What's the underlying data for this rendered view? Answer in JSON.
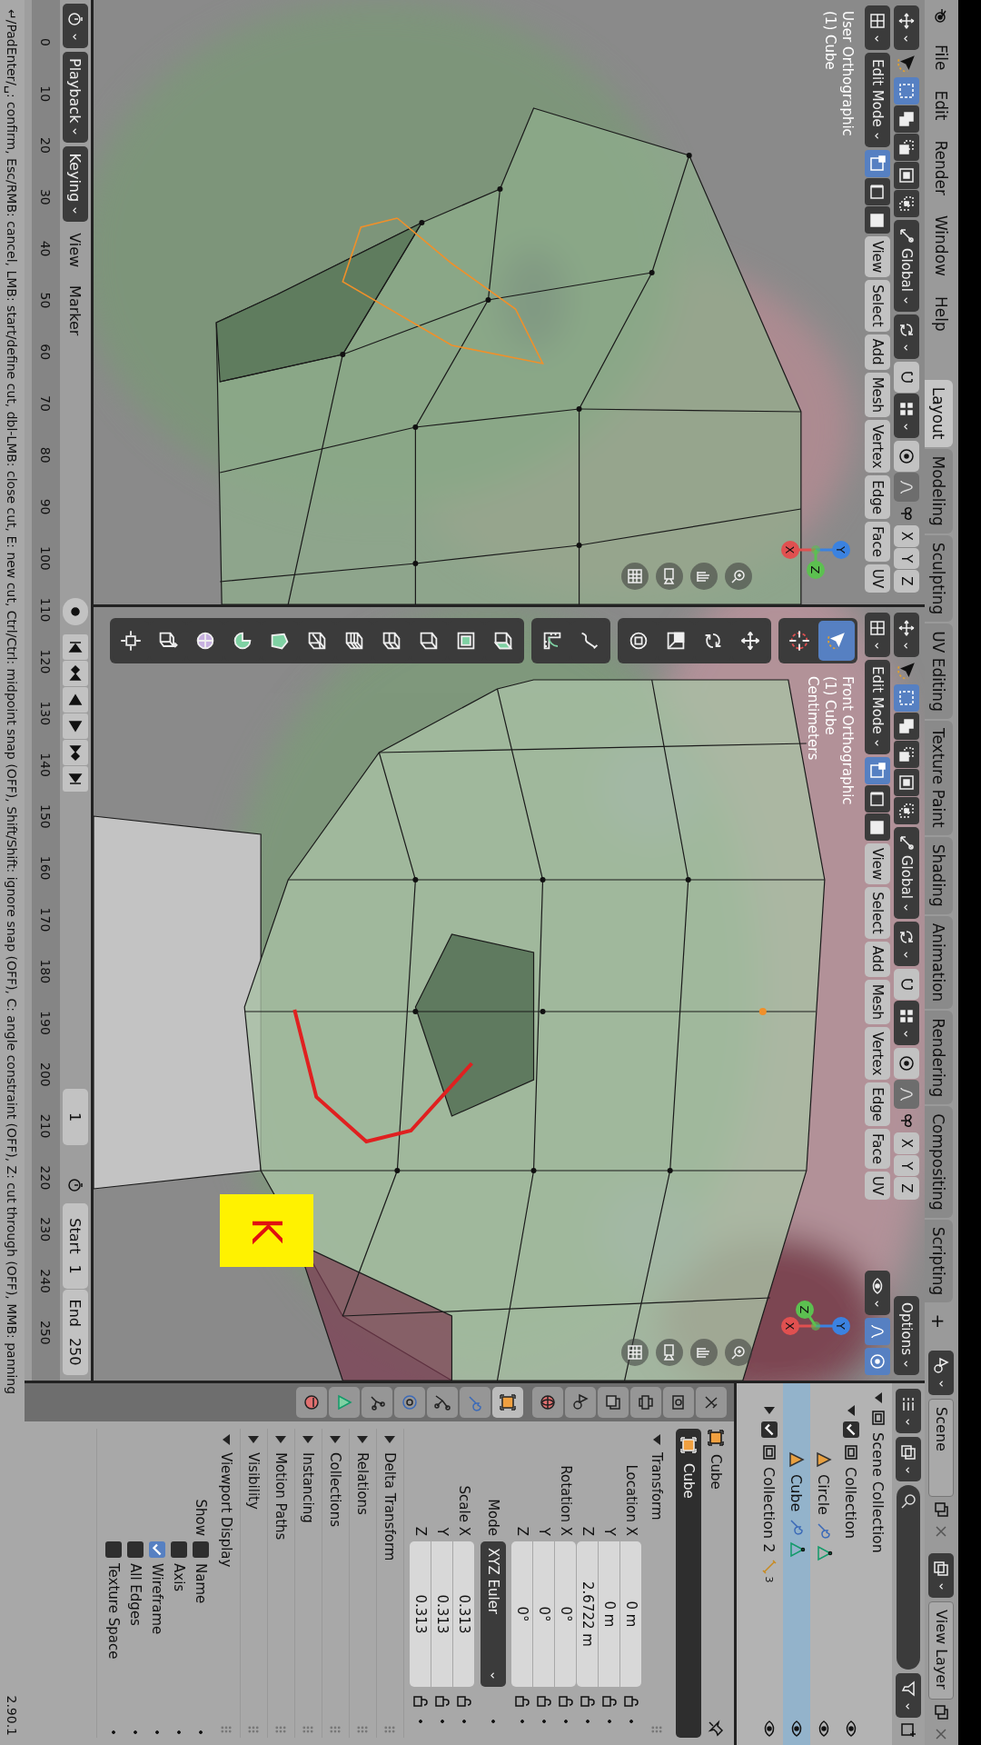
{
  "topbar": {
    "menus": [
      "File",
      "Edit",
      "Render",
      "Window",
      "Help"
    ],
    "workspaces": [
      {
        "label": "Layout",
        "selected": true
      },
      {
        "label": "Modeling",
        "selected": false
      },
      {
        "label": "Sculpting",
        "selected": false
      },
      {
        "label": "UV Editing",
        "selected": false
      },
      {
        "label": "Texture Paint",
        "selected": false
      },
      {
        "label": "Shading",
        "selected": false
      },
      {
        "label": "Animation",
        "selected": false
      },
      {
        "label": "Rendering",
        "selected": false
      },
      {
        "label": "Compositing",
        "selected": false
      },
      {
        "label": "Scripting",
        "selected": false
      }
    ],
    "add_tab": "+",
    "scene": "Scene",
    "view_layer": "View Layer"
  },
  "viewports": [
    {
      "kind": "user",
      "mode": "Edit Mode",
      "orientation": "Global",
      "box_modes": [
        {
          "selected": true
        },
        {
          "selected": false
        },
        {
          "selected": false
        },
        {
          "selected": false
        },
        {
          "selected": false
        }
      ],
      "mesh_select": [
        {
          "selected": true
        },
        {
          "selected": false
        },
        {
          "selected": false
        }
      ],
      "menus": [
        "View",
        "Select",
        "Add",
        "Mesh",
        "Vertex",
        "Edge",
        "Face",
        "UV"
      ],
      "mirror": [
        {
          "label": "X",
          "on": false
        },
        {
          "label": "Y",
          "on": false
        },
        {
          "label": "Z",
          "on": false
        }
      ],
      "info": [
        "User Orthographic",
        "(1) Cube"
      ],
      "gizmo": [
        "X",
        "Y",
        "Z"
      ]
    },
    {
      "kind": "front",
      "mode": "Edit Mode",
      "orientation": "Global",
      "box_modes": [
        {
          "selected": true
        },
        {
          "selected": false
        },
        {
          "selected": false
        },
        {
          "selected": false
        },
        {
          "selected": false
        }
      ],
      "mesh_select": [
        {
          "selected": true
        },
        {
          "selected": false
        },
        {
          "selected": false
        }
      ],
      "menus": [
        "View",
        "Select",
        "Add",
        "Mesh",
        "Vertex",
        "Edge",
        "Face",
        "UV"
      ],
      "mirror": [
        {
          "label": "X",
          "on": false
        },
        {
          "label": "Y",
          "on": false
        },
        {
          "label": "Z",
          "on": false
        }
      ],
      "info": [
        "Front Orthographic",
        "(1) Cube",
        "Centimeters"
      ],
      "gizmo": [
        "X",
        "Y",
        "Z"
      ],
      "options": "Options",
      "key_hint": "K",
      "tool_groups": [
        {
          "tools": [
            {
              "selected": true
            },
            {
              "selected": false
            }
          ]
        },
        {
          "tools": [
            {
              "selected": false
            },
            {
              "selected": false
            },
            {
              "selected": false
            },
            {
              "selected": false
            }
          ]
        },
        {
          "tools": [
            {
              "selected": false
            },
            {
              "selected": false
            }
          ]
        },
        {
          "tools": [
            {
              "selected": false
            },
            {
              "selected": false
            },
            {
              "selected": false
            },
            {
              "selected": false
            },
            {
              "selected": false
            },
            {
              "selected": false
            },
            {
              "selected": false
            },
            {
              "selected": false
            },
            {
              "selected": false
            },
            {
              "selected": false
            },
            {
              "selected": false
            }
          ]
        }
      ]
    }
  ],
  "timeline": {
    "menus": [
      {
        "label": "Playback",
        "dropdown": true
      },
      {
        "label": "Keying",
        "dropdown": true
      },
      {
        "label": "View",
        "dropdown": false
      },
      {
        "label": "Marker",
        "dropdown": false
      }
    ],
    "current_frame": "1",
    "start_label": "Start",
    "start": "1",
    "end_label": "End",
    "end": "250",
    "ticks": [
      "0",
      "10",
      "20",
      "30",
      "40",
      "50",
      "60",
      "70",
      "80",
      "90",
      "100",
      "110",
      "120",
      "130",
      "140",
      "150",
      "160",
      "170",
      "180",
      "190",
      "200",
      "210",
      "220",
      "230",
      "240",
      "250"
    ]
  },
  "outliner": {
    "tree": [
      {
        "label": "Scene Collection",
        "kind": "scene",
        "expanded": true,
        "selected": false,
        "children": [
          {
            "label": "Collection",
            "kind": "collection",
            "expanded": true,
            "checked": true,
            "selected": false,
            "children": [
              {
                "label": "Circle",
                "kind": "object",
                "selected": false
              },
              {
                "label": "Cube",
                "kind": "object",
                "selected": true
              }
            ]
          },
          {
            "label": "Collection 2",
            "kind": "collection",
            "expanded": false,
            "checked": true,
            "selected": false,
            "count": "3"
          }
        ]
      }
    ]
  },
  "properties": {
    "tabs": [
      {
        "selected": false
      },
      {
        "selected": false
      },
      {
        "selected": false
      },
      {
        "selected": false
      },
      {
        "selected": false
      },
      {
        "selected": false
      },
      {
        "selected": true
      },
      {
        "selected": false
      },
      {
        "selected": false
      },
      {
        "selected": false
      },
      {
        "selected": false
      },
      {
        "selected": false
      },
      {
        "selected": false
      }
    ],
    "object": "Cube",
    "name_field": "Cube",
    "panels": [
      {
        "title": "Transform",
        "kind": "transform",
        "expanded": true
      },
      {
        "title": "Delta Transform",
        "expanded": false
      },
      {
        "title": "Relations",
        "expanded": false
      },
      {
        "title": "Collections",
        "expanded": false
      },
      {
        "title": "Instancing",
        "expanded": false
      },
      {
        "title": "Motion Paths",
        "expanded": false
      },
      {
        "title": "Visibility",
        "expanded": false
      },
      {
        "title": "Viewport Display",
        "kind": "display",
        "expanded": true
      }
    ],
    "transform": {
      "groups": [
        {
          "label": "Location",
          "fields": [
            {
              "axis": "X",
              "value": "0 m"
            },
            {
              "axis": "Y",
              "value": "0 m"
            },
            {
              "axis": "Z",
              "value": "2.6722 m"
            }
          ]
        },
        {
          "label": "Rotation",
          "fields": [
            {
              "axis": "X",
              "value": "0°"
            },
            {
              "axis": "Y",
              "value": "0°"
            },
            {
              "axis": "Z",
              "value": "0°"
            }
          ]
        },
        {
          "label": "Scale",
          "fields": [
            {
              "axis": "X",
              "value": "0.313"
            },
            {
              "axis": "Y",
              "value": "0.313"
            },
            {
              "axis": "Z",
              "value": "0.313"
            }
          ]
        }
      ],
      "mode_label": "Mode",
      "mode": "XYZ Euler"
    },
    "display": {
      "show_label": "Show",
      "options": [
        {
          "label": "Name",
          "checked": false
        },
        {
          "label": "Axis",
          "checked": false
        },
        {
          "label": "Wireframe",
          "checked": true
        },
        {
          "label": "All Edges",
          "checked": false
        },
        {
          "label": "Texture Space",
          "checked": false
        }
      ]
    }
  },
  "status_bar": {
    "hint": "↵/PadEnter/␣: confirm, Esc/RMB: cancel, LMB: start/define cut, dbl-LMB: close cut, E: new cut, Ctrl/Ctrl: midpoint snap (OFF), Shift/Shift: ignore snap (OFF), C: angle constraint (OFF), Z: cut through (OFF), MMB: panning",
    "version": "2.90.1"
  }
}
